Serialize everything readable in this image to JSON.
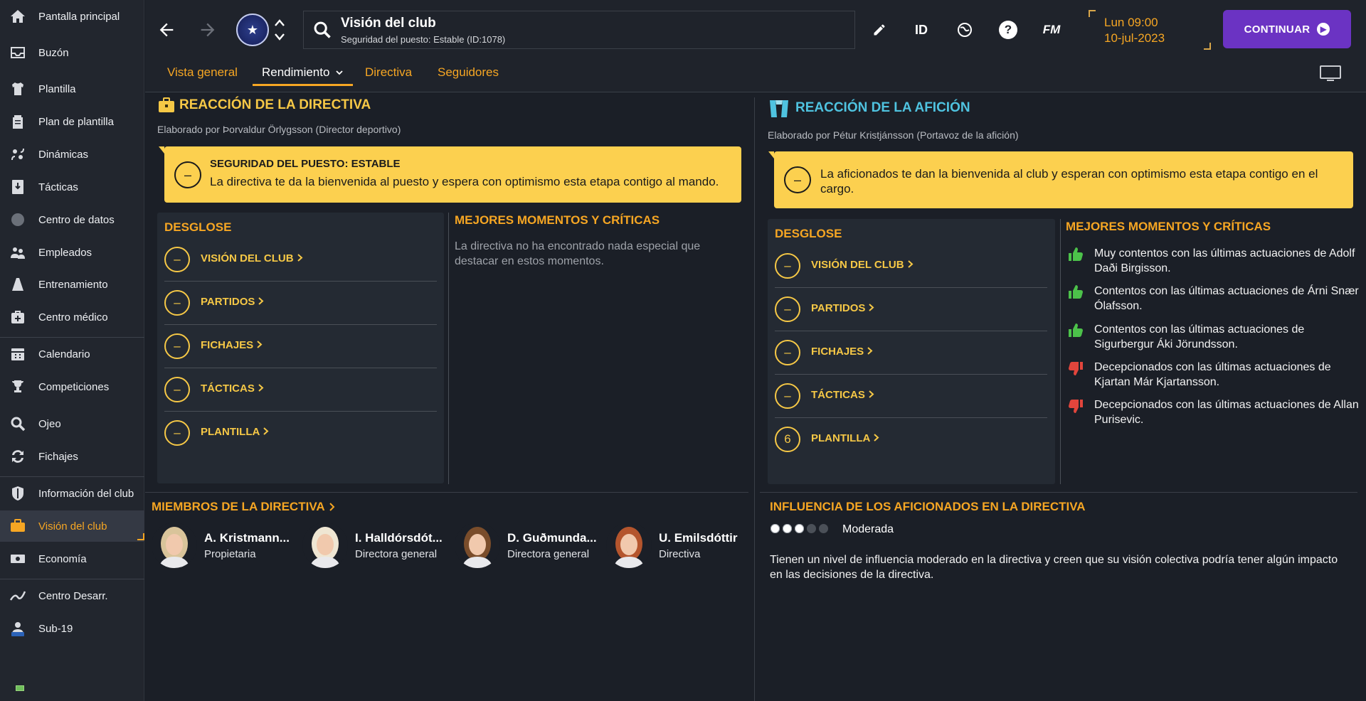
{
  "sidebar": {
    "items": [
      {
        "label": "Pantalla principal",
        "icon": "home-icon"
      },
      {
        "label": "Buzón",
        "icon": "inbox-icon"
      },
      {
        "label": "Plantilla",
        "icon": "shirt-icon"
      },
      {
        "label": "Plan de plantilla",
        "icon": "clipboard-icon"
      },
      {
        "label": "Dinámicas",
        "icon": "dynamics-icon"
      },
      {
        "label": "Tácticas",
        "icon": "tactics-board-icon"
      },
      {
        "label": "Centro de datos",
        "icon": "data-hub-icon"
      },
      {
        "label": "Empleados",
        "icon": "staff-icon"
      },
      {
        "label": "Entrenamiento",
        "icon": "training-cone-icon"
      },
      {
        "label": "Centro médico",
        "icon": "medical-kit-icon"
      },
      {
        "label": "Calendario",
        "icon": "calendar-icon"
      },
      {
        "label": "Competiciones",
        "icon": "trophy-icon"
      },
      {
        "label": "Ojeo",
        "icon": "magnifier-icon"
      },
      {
        "label": "Fichajes",
        "icon": "transfers-icon"
      },
      {
        "label": "Información del club",
        "icon": "shield-icon"
      },
      {
        "label": "Visión del club",
        "icon": "briefcase-icon"
      },
      {
        "label": "Economía",
        "icon": "money-icon"
      },
      {
        "label": "Centro Desarr.",
        "icon": "development-icon"
      },
      {
        "label": "Sub-19",
        "icon": "youth-team-icon"
      }
    ],
    "active_label": "Visión del club"
  },
  "topbar": {
    "title": "Visión del club",
    "subtitle": "Seguridad del puesto: Estable (ID:1078)",
    "id_label": "ID",
    "fm_label": "FM",
    "date_line1": "Lun 09:00",
    "date_line2": "10-jul-2023",
    "continue_label": "CONTINUAR"
  },
  "tabs": [
    {
      "label": "Vista general",
      "active": false
    },
    {
      "label": "Rendimiento",
      "active": true
    },
    {
      "label": "Directiva",
      "active": false
    },
    {
      "label": "Seguidores",
      "active": false
    }
  ],
  "board": {
    "title": "REACCIÓN DE LA DIRECTIVA",
    "author": "Elaborado por Þorvaldur Örlygsson (Director deportivo)",
    "card_heading": "SEGURIDAD DEL PUESTO: ESTABLE",
    "card_text": "La directiva te da la bienvenida al puesto y espera con optimismo esta etapa contigo al mando.",
    "card_symbol": "–",
    "breakdown_title": "DESGLOSE",
    "breakdown": [
      {
        "label": "VISIÓN DEL CLUB",
        "value": "–"
      },
      {
        "label": "PARTIDOS",
        "value": "–"
      },
      {
        "label": "FICHAJES",
        "value": "–"
      },
      {
        "label": "TÁCTICAS",
        "value": "–"
      },
      {
        "label": "PLANTILLA",
        "value": "–"
      }
    ],
    "highlights_title": "MEJORES MOMENTOS Y CRÍTICAS",
    "highlights_empty": "La directiva no ha encontrado nada especial que destacar en estos momentos."
  },
  "fans": {
    "title": "REACCIÓN DE LA AFICIÓN",
    "author": "Elaborado por Pétur Kristjánsson (Portavoz de la afición)",
    "card_text": "La aficionados te dan la bienvenida al club y esperan con optimismo esta etapa contigo en el cargo.",
    "card_symbol": "–",
    "breakdown_title": "DESGLOSE",
    "breakdown": [
      {
        "label": "VISIÓN DEL CLUB",
        "value": "–"
      },
      {
        "label": "PARTIDOS",
        "value": "–"
      },
      {
        "label": "FICHAJES",
        "value": "–"
      },
      {
        "label": "TÁCTICAS",
        "value": "–"
      },
      {
        "label": "PLANTILLA",
        "value": "6"
      }
    ],
    "highlights_title": "MEJORES MOMENTOS Y CRÍTICAS",
    "highlights": [
      {
        "text": "Muy contentos con las últimas actuaciones de Adolf Daði Birgisson.",
        "type": "positive"
      },
      {
        "text": "Contentos con las últimas actuaciones de Árni Snær Ólafsson.",
        "type": "positive"
      },
      {
        "text": "Contentos con las últimas actuaciones de Sigurbergur Áki Jörundsson.",
        "type": "positive"
      },
      {
        "text": "Decepcionados con las últimas actuaciones de Kjartan Már Kjartansson.",
        "type": "negative"
      },
      {
        "text": "Decepcionados con las últimas actuaciones de Allan Purisevic.",
        "type": "negative"
      }
    ]
  },
  "members": {
    "title": "MIEMBROS DE LA DIRECTIVA",
    "list": [
      {
        "name": "A. Kristmann...",
        "role": "Propietaria"
      },
      {
        "name": "I. Halldórsdót...",
        "role": "Directora general"
      },
      {
        "name": "D. Guðmunda...",
        "role": "Directora general"
      },
      {
        "name": "U. Emilsdóttir",
        "role": "Directiva"
      }
    ]
  },
  "influence": {
    "title": "INFLUENCIA DE LOS AFICIONADOS EN LA DIRECTIVA",
    "level_label": "Moderada",
    "level_filled": 3,
    "level_max": 5,
    "description": "Tienen un nivel de influencia moderado en la directiva y creen que su visión colectiva podría tener algún impacto en las decisiones de la directiva."
  },
  "colors": {
    "accent": "#f6a623",
    "card_yellow": "#fcd04f",
    "fan_title": "#4fc3e0",
    "continue": "#6b33c3",
    "positive": "#4cc24a",
    "negative": "#e2453c"
  }
}
